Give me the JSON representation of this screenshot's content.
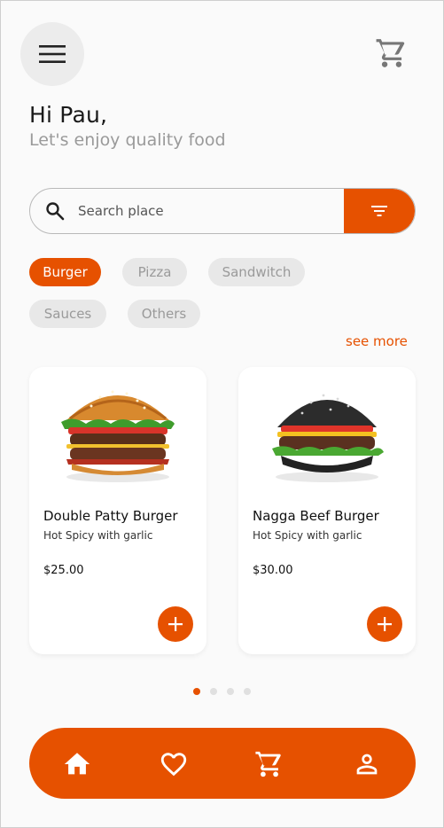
{
  "header": {
    "greeting": "Hi Pau,",
    "subtitle": "Let's enjoy quality food",
    "menu_icon": "hamburger-menu-icon",
    "cart_icon": "cart-icon"
  },
  "search": {
    "placeholder": "Search place",
    "value": "",
    "search_icon": "search-icon",
    "filter_icon": "filter-icon"
  },
  "categories": [
    {
      "label": "Burger",
      "active": true
    },
    {
      "label": "Pizza",
      "active": false
    },
    {
      "label": "Sandwitch",
      "active": false
    },
    {
      "label": "Sauces",
      "active": false
    },
    {
      "label": "Others",
      "active": false
    }
  ],
  "see_more": "see more",
  "products": [
    {
      "name": "Double Patty Burger",
      "desc": "Hot Spicy with garlic",
      "price": "$25.00",
      "image": "double-patty-burger-image"
    },
    {
      "name": "Nagga Beef Burger",
      "desc": "Hot Spicy with garlic",
      "price": "$30.00",
      "image": "black-bun-beef-burger-image"
    }
  ],
  "pagination": {
    "count": 4,
    "active_index": 0
  },
  "bottom_nav": [
    {
      "icon": "home-icon"
    },
    {
      "icon": "heart-icon"
    },
    {
      "icon": "cart-icon"
    },
    {
      "icon": "profile-icon"
    }
  ],
  "colors": {
    "accent": "#e65100",
    "chip_bg": "#e8e8e8",
    "background": "#fafafa",
    "muted_text": "#9a9a9a"
  }
}
